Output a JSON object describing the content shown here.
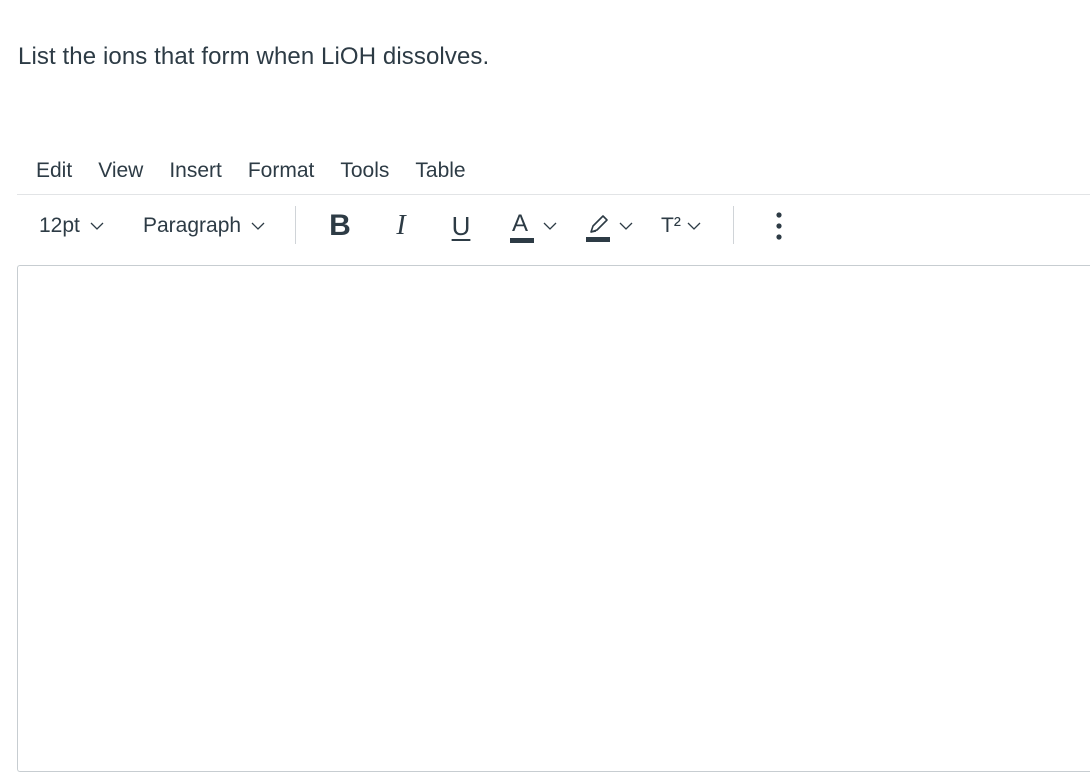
{
  "question": {
    "text": "List the ions that form when LiOH dissolves."
  },
  "menubar": {
    "items": [
      {
        "label": "Edit"
      },
      {
        "label": "View"
      },
      {
        "label": "Insert"
      },
      {
        "label": "Format"
      },
      {
        "label": "Tools"
      },
      {
        "label": "Table"
      }
    ]
  },
  "toolbar": {
    "font_size": "12pt",
    "block_format": "Paragraph",
    "icons": {
      "bold": "bold-icon",
      "italic": "italic-icon",
      "underline": "underline-icon",
      "text_color": "text-color-icon",
      "highlight": "highlight-icon",
      "superscript": "superscript-icon",
      "more": "more-vertical-icon"
    },
    "bold_glyph": "B",
    "italic_glyph": "I",
    "underline_glyph": "U",
    "text_color_glyph": "A",
    "superscript_glyph": "T²"
  },
  "colors": {
    "text": "#2d3b45",
    "border": "#c7cdd1",
    "divider": "#e2e4e6"
  },
  "editor": {
    "content": ""
  }
}
